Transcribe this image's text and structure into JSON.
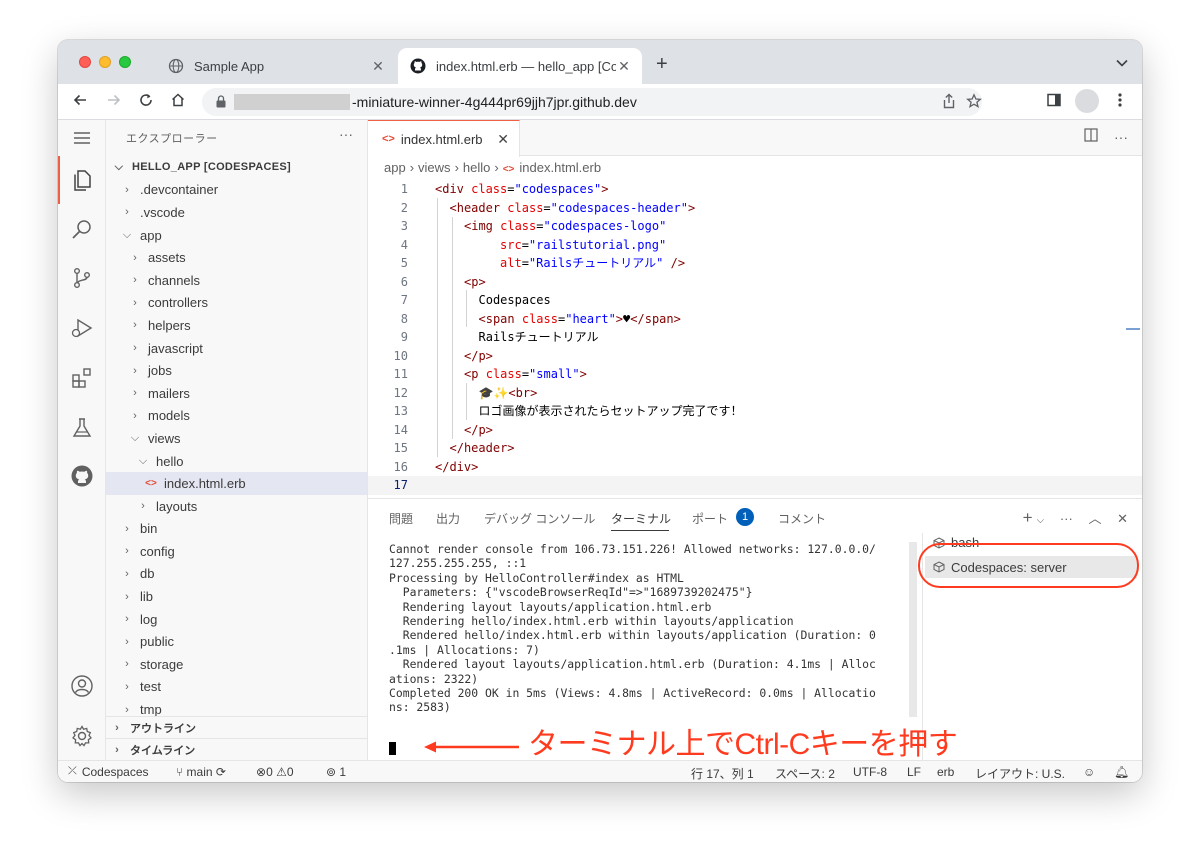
{
  "browser": {
    "tabs": [
      {
        "title": "Sample App"
      },
      {
        "title": "index.html.erb — hello_app [Codespaces]"
      }
    ],
    "url": "-miniature-winner-4g444pr69jjh7jpr.github.dev"
  },
  "explorer": {
    "title": "エクスプローラー",
    "root": "HELLO_APP [CODESPACES]",
    "items": [
      {
        "label": ".devcontainer"
      },
      {
        "label": ".vscode"
      },
      {
        "label": "app"
      },
      {
        "label": "assets"
      },
      {
        "label": "channels"
      },
      {
        "label": "controllers"
      },
      {
        "label": "helpers"
      },
      {
        "label": "javascript"
      },
      {
        "label": "jobs"
      },
      {
        "label": "mailers"
      },
      {
        "label": "models"
      },
      {
        "label": "views"
      },
      {
        "label": "hello"
      },
      {
        "label": "index.html.erb"
      },
      {
        "label": "layouts"
      },
      {
        "label": "bin"
      },
      {
        "label": "config"
      },
      {
        "label": "db"
      },
      {
        "label": "lib"
      },
      {
        "label": "log"
      },
      {
        "label": "public"
      },
      {
        "label": "storage"
      },
      {
        "label": "test"
      },
      {
        "label": "tmp"
      }
    ],
    "outline": "アウトライン",
    "timeline": "タイムライン"
  },
  "editor": {
    "tab": "index.html.erb",
    "breadcrumb": [
      "app",
      "views",
      "hello",
      "index.html.erb"
    ],
    "line_numbers": [
      "1",
      "2",
      "3",
      "4",
      "5",
      "6",
      "7",
      "8",
      "9",
      "10",
      "11",
      "12",
      "13",
      "14",
      "15",
      "16",
      "17"
    ],
    "code": {
      "l1a": "<div ",
      "l1b": "class",
      "l1c": "=",
      "l1d": "\"codespaces\"",
      "l1e": ">",
      "l2a": "<header ",
      "l2b": "class",
      "l2c": "=",
      "l2d": "\"codespaces-header\"",
      "l2e": ">",
      "l3a": "<img ",
      "l3b": "class",
      "l3c": "=",
      "l3d": "\"codespaces-logo\"",
      "l4b": "src",
      "l4c": "=",
      "l4d": "\"railstutorial.png\"",
      "l5b": "alt",
      "l5c": "=",
      "l5d": "\"Railsチュートリアル\"",
      "l5e": " />",
      "l6a": "<p>",
      "l7a": "Codespaces",
      "l8a": "<span ",
      "l8b": "class",
      "l8c": "=",
      "l8d": "\"heart\"",
      "l8e": ">",
      "l8f": "♥",
      "l8g": "</span>",
      "l9a": "Railsチュートリアル",
      "l10a": "</p>",
      "l11a": "<p ",
      "l11b": "class",
      "l11c": "=",
      "l11d": "\"small\"",
      "l11e": ">",
      "l12a": "🎓✨",
      "l12b": "<br>",
      "l13a": "ロゴ画像が表示されたらセットアップ完了です！",
      "l14a": "</p>",
      "l15a": "</header>",
      "l16a": "</div>"
    }
  },
  "panel": {
    "tabs": [
      "問題",
      "出力",
      "デバッグ コンソール",
      "ターミナル",
      "ポート",
      "コメント"
    ],
    "ports_badge": "1",
    "terminal_lines": [
      "Cannot render console from 106.73.151.226! Allowed networks: 127.0.0.0/",
      "127.255.255.255, ::1",
      "Processing by HelloController#index as HTML",
      "  Parameters: {\"vscodeBrowserReqId\"=>\"1689739202475\"}",
      "  Rendering layout layouts/application.html.erb",
      "  Rendering hello/index.html.erb within layouts/application",
      "  Rendered hello/index.html.erb within layouts/application (Duration: 0",
      ".1ms | Allocations: 7)",
      "  Rendered layout layouts/application.html.erb (Duration: 4.1ms | Alloc",
      "ations: 2322)",
      "Completed 200 OK in 5ms (Views: 4.8ms | ActiveRecord: 0.0ms | Allocatio",
      "ns: 2583)"
    ],
    "terminals": [
      "bash",
      "Codespaces: server"
    ]
  },
  "annotation": {
    "text": "ターミナル上でCtrl-Cキーを押す",
    "color": "#ff3b1f"
  },
  "statusbar": {
    "remote": "Codespaces",
    "branch": "main",
    "errors": "0",
    "warnings": "0",
    "ports": "1",
    "position": "行 17、列 1",
    "spaces": "スペース: 2",
    "encoding": "UTF-8",
    "eol": "LF",
    "language": "erb",
    "layout": "レイアウト: U.S."
  },
  "colors": {
    "accent": "#ef5f44",
    "badge": "#005fb8"
  }
}
